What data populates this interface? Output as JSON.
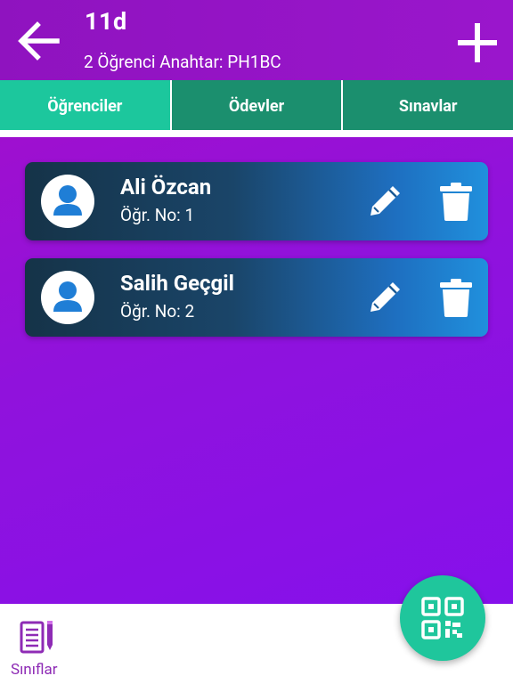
{
  "header": {
    "title": "11d",
    "subtitle": "2 Öğrenci Anahtar: PH1BC",
    "back_icon": "arrow-left-icon",
    "add_icon": "plus-icon"
  },
  "tabs": [
    {
      "label": "Öğrenciler",
      "active": true
    },
    {
      "label": "Ödevler",
      "active": false
    },
    {
      "label": "Sınavlar",
      "active": false
    }
  ],
  "students": [
    {
      "name": "Ali Özcan",
      "number_text": "Öğr. No: 1"
    },
    {
      "name": "Salih Geçgil",
      "number_text": "Öğr. No: 2"
    }
  ],
  "card_icons": {
    "avatar": "person-icon",
    "edit": "pencil-icon",
    "delete": "trash-icon"
  },
  "bottom_nav": {
    "label": "Sınıflar",
    "icon": "notebook-icon"
  },
  "fab": {
    "icon": "qr-code-icon"
  },
  "colors": {
    "background": "#9012dc",
    "tab_active": "#1cc79d",
    "tab_inactive": "#1b8f6e",
    "card_start": "#153348",
    "card_end": "#2090dd",
    "avatar_icon": "#1f7ed6",
    "nav_accent": "#8e2bb5",
    "fab": "#1fc69c"
  }
}
